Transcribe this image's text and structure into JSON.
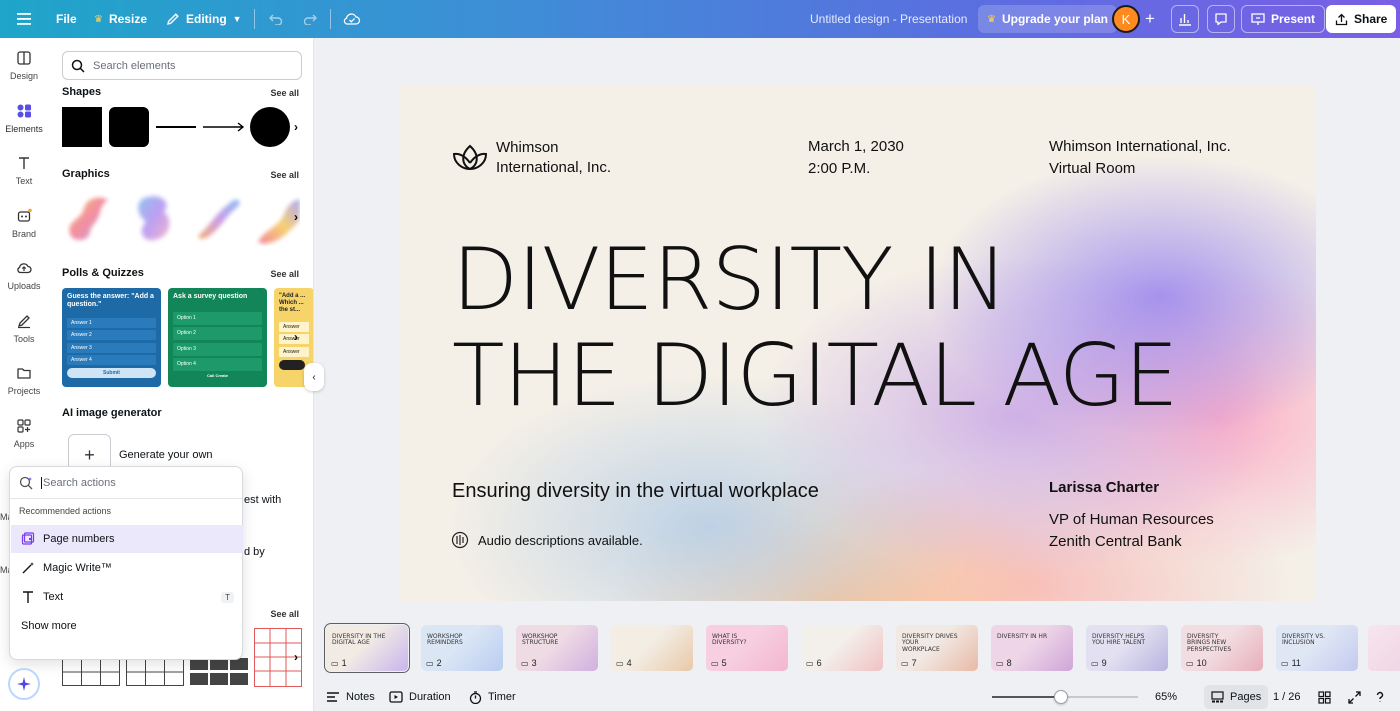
{
  "topbar": {
    "file": "File",
    "resize": "Resize",
    "editing": "Editing",
    "doc_title": "Untitled design - Presentation",
    "upgrade": "Upgrade your plan",
    "avatar_initial": "K",
    "present": "Present",
    "share": "Share"
  },
  "rail": {
    "items": [
      {
        "label": "Design",
        "icon": "layout-icon"
      },
      {
        "label": "Elements",
        "icon": "shapes-icon"
      },
      {
        "label": "Text",
        "icon": "text-icon"
      },
      {
        "label": "Brand",
        "icon": "brand-icon"
      },
      {
        "label": "Uploads",
        "icon": "cloud-upload-icon"
      },
      {
        "label": "Tools",
        "icon": "pen-icon"
      },
      {
        "label": "Projects",
        "icon": "folder-icon"
      },
      {
        "label": "Apps",
        "icon": "apps-icon"
      }
    ]
  },
  "panel": {
    "search_placeholder": "Search elements",
    "see_all": "See all",
    "sections": {
      "shapes": "Shapes",
      "graphics": "Graphics",
      "polls": "Polls & Quizzes",
      "ai": "AI image generator"
    },
    "polls": [
      {
        "title": "Guess the answer: \"Add a question.\"",
        "rows": [
          "Answer 1",
          "Answer 2",
          "Answer 3",
          "Answer 4"
        ],
        "button": "Submit"
      },
      {
        "title": "Ask a survey question",
        "rows": [
          "Option 1",
          "Option 2",
          "Option 3",
          "Option 4"
        ],
        "button": "Call Create"
      },
      {
        "title": "\"Add a ... Which ... the st...",
        "rows": [
          "Answer",
          "Answer",
          "Answer"
        ],
        "button": ""
      }
    ],
    "ai_generate": "Generate your own",
    "partial_1": "est with",
    "partial_2": "d by",
    "partial_rail_1": "Ma",
    "partial_rail_2": "Ma"
  },
  "popup": {
    "placeholder": "Search actions",
    "subtitle": "Recommended actions",
    "items": [
      {
        "label": "Page numbers",
        "icon": "page-numbers-icon"
      },
      {
        "label": "Magic Write™",
        "icon": "magic-wand-icon"
      },
      {
        "label": "Text",
        "icon": "text-icon",
        "shortcut": "T"
      }
    ],
    "show_more": "Show more"
  },
  "slide": {
    "company_line1": "Whimson",
    "company_line2": "International, Inc.",
    "date": "March 1, 2030",
    "time": "2:00 P.M.",
    "venue_line1": "Whimson International, Inc.",
    "venue_line2": "Virtual Room",
    "title_line1": "DIVERSITY IN",
    "title_line2": "THE DIGITAL AGE",
    "subtitle": "Ensuring diversity in the virtual workplace",
    "audio_note": "Audio descriptions available.",
    "presenter": "Larissa Charter",
    "presenter_role": "VP of Human Resources",
    "presenter_org": "Zenith Central Bank"
  },
  "thumbnails": [
    {
      "num": "1",
      "title": "DIVERSITY IN THE DIGITAL AGE",
      "bg": "#f1ebe4",
      "accent": "#c9b4ee"
    },
    {
      "num": "2",
      "title": "WORKSHOP REMINDERS",
      "bg": "#dbe6f5",
      "accent": "#b9cdf0"
    },
    {
      "num": "3",
      "title": "WORKSHOP STRUCTURE",
      "bg": "#eedbe4",
      "accent": "#d1b0e0"
    },
    {
      "num": "4",
      "title": "",
      "bg": "#f3ede4",
      "accent": "#e9c9a9"
    },
    {
      "num": "5",
      "title": "WHAT IS DIVERSITY?",
      "bg": "#f7cfe0",
      "accent": "#f3b6cf"
    },
    {
      "num": "6",
      "title": "",
      "bg": "#f3efea",
      "accent": "#f0c2c2"
    },
    {
      "num": "7",
      "title": "DIVERSITY DRIVES YOUR WORKPLACE",
      "bg": "#f1e9e3",
      "accent": "#e9b9a7"
    },
    {
      "num": "8",
      "title": "DIVERSITY IN HR",
      "bg": "#eed6e8",
      "accent": "#cfa6d8"
    },
    {
      "num": "9",
      "title": "DIVERSITY HELPS YOU HIRE TALENT",
      "bg": "#e3e1f1",
      "accent": "#b8b3e0"
    },
    {
      "num": "10",
      "title": "DIVERSITY BRINGS NEW PERSPECTIVES",
      "bg": "#f2dde3",
      "accent": "#e7aeb7"
    },
    {
      "num": "11",
      "title": "DIVERSITY VS. INCLUSION",
      "bg": "#dfe7f5",
      "accent": "#c4c9ef"
    }
  ],
  "bottom": {
    "notes": "Notes",
    "duration": "Duration",
    "timer": "Timer",
    "zoom": "65%",
    "zoom_fraction": 0.47,
    "pages": "Pages",
    "page_count": "1 / 26"
  }
}
